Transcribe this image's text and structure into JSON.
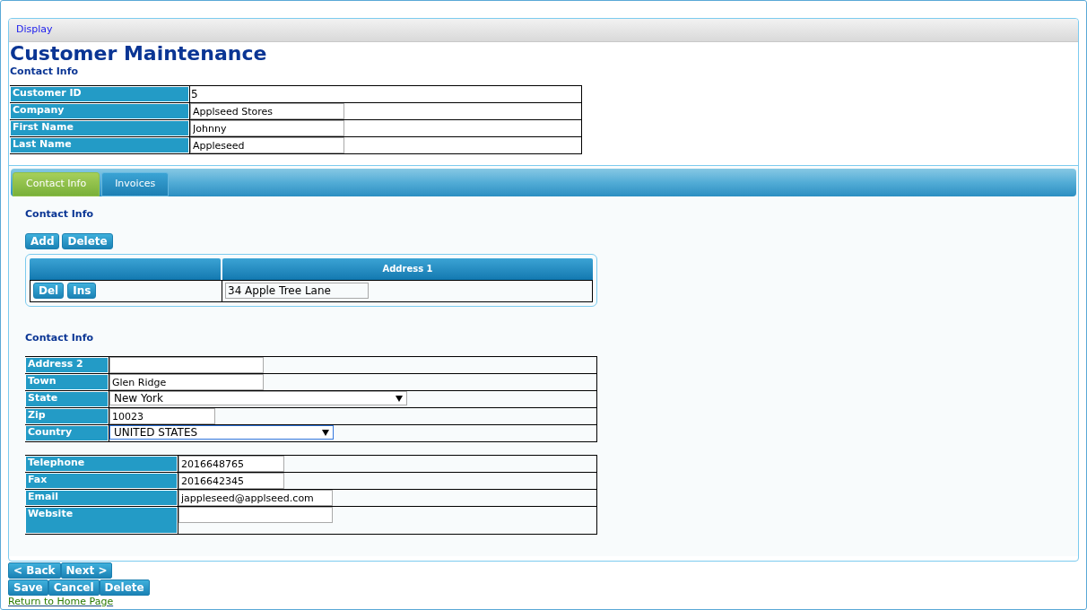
{
  "header": {
    "label": "Display"
  },
  "title": "Customer Maintenance",
  "subtitle": "Contact Info",
  "customer_fields": [
    {
      "label": "Customer ID",
      "kind": "text",
      "value": "5"
    },
    {
      "label": "Company",
      "kind": "input",
      "value": "Applseed Stores"
    },
    {
      "label": "First Name",
      "kind": "input",
      "value": "Johnny"
    },
    {
      "label": "Last Name",
      "kind": "input",
      "value": "Appleseed"
    }
  ],
  "tabs": [
    {
      "label": "Contact Info",
      "selected": true
    },
    {
      "label": "Invoices",
      "selected": false
    }
  ],
  "section_title": "Contact Info",
  "grid_actions": [
    "Add",
    "Delete"
  ],
  "grid": {
    "column_2": "Address 1",
    "rows": [
      {
        "actions": [
          "Del",
          "Ins"
        ],
        "address_1": "34 Apple Tree Lane"
      }
    ]
  },
  "details_title": "Contact Info",
  "address_fields": [
    {
      "label": "Address 2",
      "kind": "input"
    },
    {
      "label": "Town",
      "kind": "input",
      "value": "Glen Ridge"
    },
    {
      "label": "State",
      "kind": "wide-select",
      "value": "New York"
    },
    {
      "label": "Zip",
      "kind": "short-input",
      "value": "10023"
    },
    {
      "label": "Country",
      "kind": "select",
      "value": "UNITED STATES",
      "focused": true
    }
  ],
  "contact_fields": [
    {
      "label": "Telephone",
      "kind": "short-input",
      "value": "2016648765"
    },
    {
      "label": "Fax",
      "kind": "short-input",
      "value": "2016642345"
    },
    {
      "label": "Email",
      "kind": "input",
      "value": "jappleseed@applseed.com"
    },
    {
      "label": "Website",
      "kind": "tall-input"
    }
  ],
  "nav_buttons": [
    "< Back",
    "Next >"
  ],
  "form_buttons": [
    "Save",
    "Cancel",
    "Delete"
  ],
  "home_link": "Return to Home Page"
}
